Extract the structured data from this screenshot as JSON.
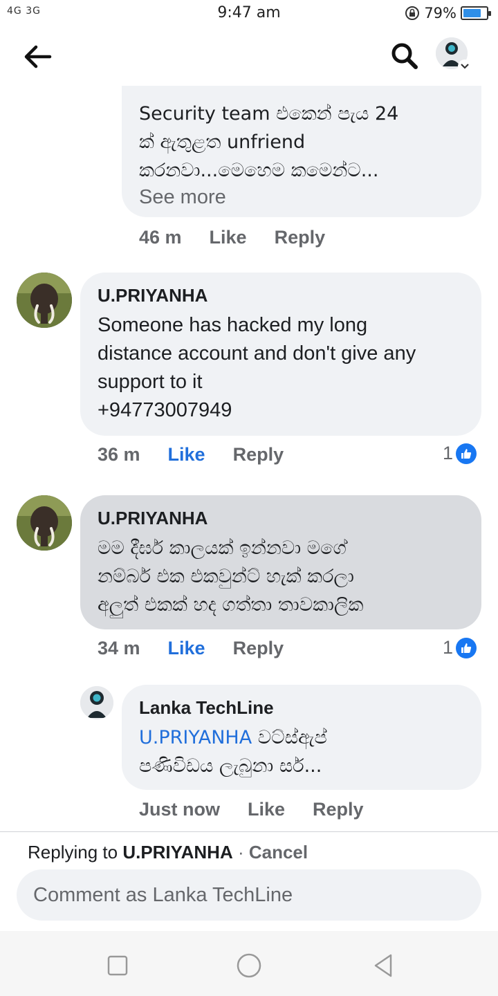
{
  "status_bar": {
    "network": "4G 3G",
    "time": "9:47 am",
    "battery_text": "79%",
    "battery_level": 0.79
  },
  "header": {
    "back_icon": "arrow-left-icon",
    "search_icon": "search-icon"
  },
  "comments": [
    {
      "text_lines": [
        "Security team එකෙන් පැය 24",
        "ක් ඇතුළත unfriend",
        "කරනවා...මෙහෙම කමෙන්ට..."
      ],
      "see_more": "See more",
      "time": "46 m",
      "like": "Like",
      "reply": "Reply"
    },
    {
      "author": "U.PRIYANHA",
      "text_lines": [
        "Someone has hacked my long",
        "distance account and don't give any",
        "support to it",
        "+94773007949"
      ],
      "time": "36 m",
      "like": "Like",
      "reply": "Reply",
      "reactions": "1"
    },
    {
      "author": "U.PRIYANHA",
      "text_lines": [
        "මම දීර්ඝ කාලයක් ඉන්නවා මගේ",
        "නම්බර් එක එකවුන්ට් හැක් කරලා",
        "අලුත් එකක් හද ගත්තා තාවකාලික"
      ],
      "time": "34 m",
      "like": "Like",
      "reply": "Reply",
      "reactions": "1"
    },
    {
      "author": "Lanka TechLine",
      "mention": "U.PRIYANHA",
      "text_line1_rest": " වට්ස්ඇප්",
      "text_line2": "පණිවිඩය ලැබුනා සර්...",
      "time": "Just now",
      "like": "Like",
      "reply": "Reply"
    }
  ],
  "reply_bar": {
    "replying_prefix": "Replying to ",
    "replying_to": "U.PRIYANHA",
    "separator": " · ",
    "cancel": "Cancel",
    "placeholder": "Comment as Lanka TechLine"
  },
  "colors": {
    "link_blue": "#216fdb",
    "bubble_bg": "#f0f2f5",
    "bubble_selected": "#d9dbdf",
    "meta_gray": "#65676b"
  }
}
